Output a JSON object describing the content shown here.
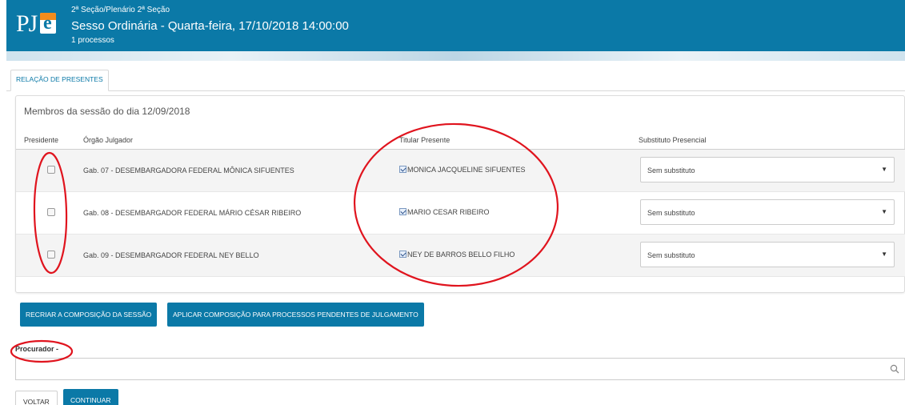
{
  "header": {
    "logo_text": "PJe",
    "subtitle": "2ª Seção/Plenário 2ª Seção",
    "title": "Sesso Ordinária - Quarta-feira, 17/10/2018 14:00:00",
    "count": "1 processos",
    "color": "#0b79a7"
  },
  "tabs": [
    {
      "label": "RELAÇÃO DE PRESENTES",
      "active": true
    }
  ],
  "panel": {
    "title": "Membros da sessão do dia 12/09/2018",
    "columns": [
      "Presidente",
      "Órgão Julgador",
      "Titular Presente",
      "Substituto Presencial"
    ],
    "rows": [
      {
        "presidente": false,
        "orgao": "Gab. 07 - DESEMBARGADORA FEDERAL MÔNICA SIFUENTES",
        "titular_checked": true,
        "titular": "MONICA JACQUELINE SIFUENTES",
        "substituto": "Sem substituto"
      },
      {
        "presidente": false,
        "orgao": "Gab. 08 - DESEMBARGADOR FEDERAL MÁRIO CÉSAR RIBEIRO",
        "titular_checked": true,
        "titular": "MARIO CESAR RIBEIRO",
        "substituto": "Sem substituto"
      },
      {
        "presidente": false,
        "orgao": "Gab. 09 - DESEMBARGADOR FEDERAL NEY BELLO",
        "titular_checked": true,
        "titular": "NEY DE BARROS BELLO FILHO",
        "substituto": "Sem substituto"
      }
    ]
  },
  "actions": {
    "recriar_label": "RECRIAR A COMPOSIÇÃO DA SESSÃO",
    "aplicar_label": "APLICAR COMPOSIÇÃO PARA PROCESSOS PENDENTES DE JULGAMENTO"
  },
  "procurador": {
    "label": "Procurador -",
    "value": "",
    "icon": "search-icon"
  },
  "footer": {
    "voltar_label": "VOLTAR",
    "continuar_label": "CONTINUAR"
  },
  "annotation_color": "#e0141e"
}
